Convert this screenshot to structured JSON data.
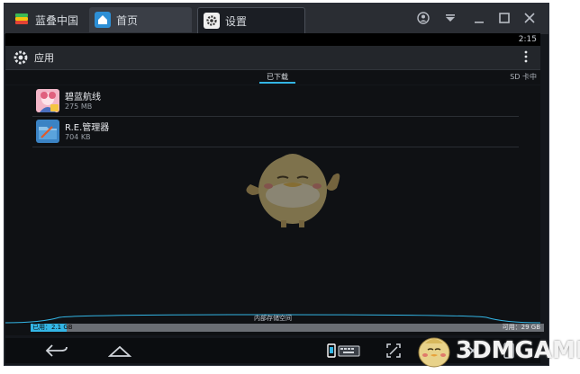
{
  "titlebar": {
    "app_name": "蓝叠中国",
    "tabs": [
      {
        "label": "首页"
      },
      {
        "label": "设置"
      }
    ]
  },
  "statusbar": {
    "time": "2:15"
  },
  "actionbar": {
    "title": "应用"
  },
  "subtabs": {
    "downloaded": "已下载",
    "sdcard": "SD 卡中"
  },
  "apps": [
    {
      "name": "碧蓝航线",
      "size": "275 MB"
    },
    {
      "name": "R.E.管理器",
      "size": "704 KB"
    }
  ],
  "storage": {
    "label": "内部存储空间",
    "used": "已用：2.1 GB",
    "free": "可用：29 GB",
    "used_fraction": 0.07
  },
  "watermark": {
    "text": "3DMGAME"
  },
  "colors": {
    "accent": "#33b5e5",
    "titlebar": "#2a2d33",
    "background": "#0f1114"
  }
}
